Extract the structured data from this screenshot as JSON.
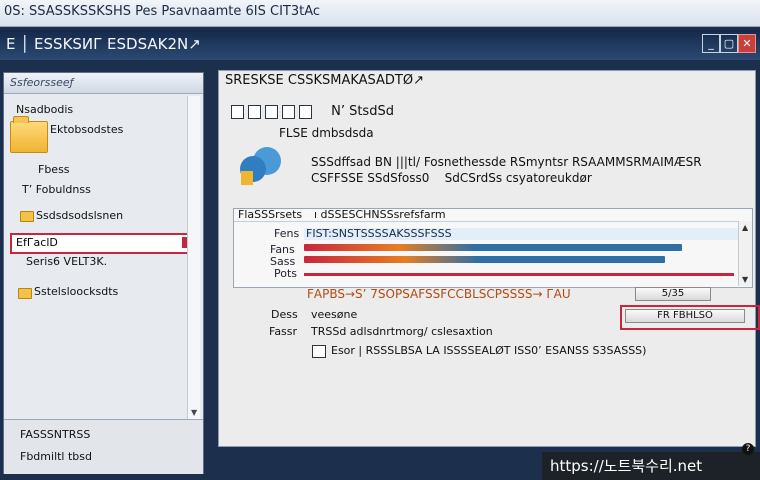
{
  "window": {
    "title": "0S: SSASSKSSKSHS Pes Psavnaamte 6IS  CIT3tAc",
    "menu": "E │ ESSKSИГ ESDSAK2N↗"
  },
  "left_pane": {
    "header": "Ssfeorsseeƒ",
    "items": [
      {
        "label": "Nsadbodis"
      },
      {
        "label": "Ektobsodstes"
      },
      {
        "label": "Fbess"
      },
      {
        "label": "T’ Fobuldnss"
      },
      {
        "label": "Ssdsdsodslsnen"
      },
      {
        "label": "EfГасlD"
      },
      {
        "label": "Seris6 VELT3K."
      },
      {
        "label": "Sstelsloocksdts"
      }
    ],
    "selected_index": 5,
    "footer": [
      "FASSSNTRSS",
      "Fbdmiltl tbsd"
    ]
  },
  "main": {
    "title": "SRESKSE CSSKSMAKASADTØ↗",
    "toolbar_label": "N’ StsdSd",
    "subtitle": "FLSE dmbsdsda",
    "description": [
      "SSSdffsad BN |||tl/ Fosnethessde RSmyntsr RSAAMMSRMAIMÆSR",
      "CSFFSSE SSdSfoss0    SdCSrdSs csyatoreukdør"
    ],
    "group": {
      "header_left": "FlaSSSrsets",
      "header_right": "ı dSSESCHNSSsrefsfarm",
      "labels": [
        "Fens",
        "Fans",
        "Sass",
        "Pots"
      ],
      "list_header": "FIST:SNSTSSSSAKSSSFSSS",
      "progress": [
        0.86,
        0.82
      ]
    },
    "status_orange": "FАРBS→S’ 7SOPSAFSSFCCBLSCPSSSS→ ГАU",
    "browse_button": "5/35",
    "desc_label": "Dess",
    "desc_value": "veesøne",
    "ok_button": "FR FBHLSO",
    "prop_label": "Fassr",
    "prop_value": "TRSSd  adlsdnrtmorg/ cslesaxtion",
    "checkbox_label": "Esor | RSSSLBSA LA  ISSSSEALØT ISS0’ ESANSS S3SASSS)"
  },
  "watermark": "https://노트북수리.net",
  "colors": {
    "highlight": "#c8263c",
    "titlebar_dark": "#15294a",
    "progress_blue": "#2e6fa6",
    "progress_red": "#c8263c"
  }
}
